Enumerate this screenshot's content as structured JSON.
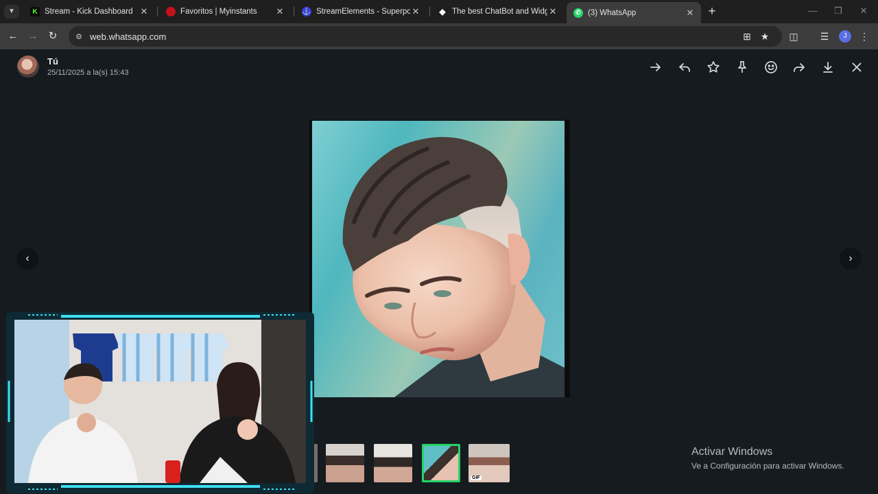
{
  "browser": {
    "tabs": [
      {
        "title": "Stream - Kick Dashboard",
        "favicon": "kick-icon",
        "color": "#53fc18",
        "active": false
      },
      {
        "title": "Favoritos | Myinstants",
        "favicon": "myinstants-icon",
        "color": "#c4121a",
        "active": false
      },
      {
        "title": "StreamElements - Superposicio",
        "favicon": "streamelements-icon",
        "color": "#3d3dd9",
        "active": false
      },
      {
        "title": "The best ChatBot and Widgets",
        "favicon": "diamond-icon",
        "color": "#ffffff",
        "active": false
      },
      {
        "title": "(3) WhatsApp",
        "favicon": "whatsapp-icon",
        "color": "#25d366",
        "active": true
      }
    ],
    "url": "web.whatsapp.com",
    "profile_initial": "J"
  },
  "viewer": {
    "sender": "Tú",
    "timestamp": "25/11/2025 a la(s) 15:43",
    "actions": [
      "forward-icon",
      "reply-icon",
      "star-icon",
      "pin-icon",
      "emoji-icon",
      "share-icon",
      "download-icon",
      "close-icon"
    ],
    "thumbnails": [
      {
        "name": "thumb-1",
        "selected": false,
        "gif": false
      },
      {
        "name": "thumb-2",
        "selected": false,
        "gif": false
      },
      {
        "name": "thumb-3",
        "selected": true,
        "gif": false
      },
      {
        "name": "thumb-4",
        "selected": false,
        "gif": true
      }
    ],
    "gif_label": "GIF"
  },
  "windows_watermark": {
    "title": "Activar Windows",
    "subtitle": "Ve a Configuración para activar Windows."
  },
  "colors": {
    "accent": "#25d366",
    "overlay_cyan": "#3fe0f0"
  }
}
